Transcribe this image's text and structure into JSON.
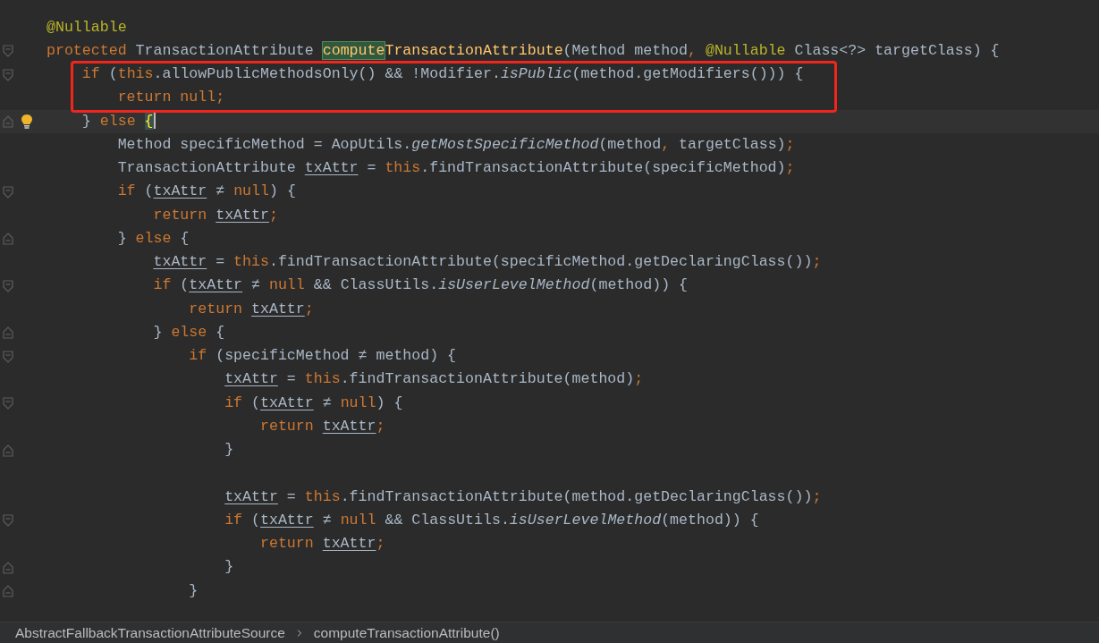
{
  "editor": {
    "lines": [
      {
        "tokens": [
          {
            "text": "@Nullable",
            "kind": "ann"
          }
        ],
        "current": false,
        "framed": false,
        "bulb": false
      },
      {
        "tokens": [
          {
            "text": "protected ",
            "kind": "kw"
          },
          {
            "text": "TransactionAttribute ",
            "kind": "plain"
          },
          {
            "text": "compute",
            "kind": "match"
          },
          {
            "text": "TransactionAttribute",
            "kind": "decl"
          },
          {
            "text": "(Method method",
            "kind": "plain"
          },
          {
            "text": ", ",
            "kind": "kw"
          },
          {
            "text": "@Nullable",
            "kind": "ann"
          },
          {
            "text": " Class<?> targetClass) {",
            "kind": "plain"
          }
        ],
        "fold_marker": {
          "kind": "open"
        },
        "current": false,
        "framed": false,
        "bulb": false
      },
      {
        "tokens": [
          {
            "text": "    if",
            "kind": "kw"
          },
          {
            "text": " (",
            "kind": "plain"
          },
          {
            "text": "this",
            "kind": "kw"
          },
          {
            "text": ".allowPublicMethodsOnly() && !Modifier.",
            "kind": "plain"
          },
          {
            "text": "isPublic",
            "kind": "static"
          },
          {
            "text": "(method.getModifiers())) {",
            "kind": "plain"
          }
        ],
        "fold_marker": {
          "kind": "open"
        },
        "current": false,
        "framed": true,
        "bulb": false
      },
      {
        "tokens": [
          {
            "text": "        return null;",
            "kind": "kw"
          }
        ],
        "current": false,
        "framed": true,
        "bulb": false
      },
      {
        "tokens": [
          {
            "text": "    }",
            "kind": "plain"
          },
          {
            "text": " else ",
            "kind": "kw"
          },
          {
            "text": "{",
            "kind": "brace"
          }
        ],
        "fold_marker": {
          "kind": "close"
        },
        "current": true,
        "framed": false,
        "bulb": true
      },
      {
        "tokens": [
          {
            "text": "        Method specificMethod = AopUtils.",
            "kind": "plain"
          },
          {
            "text": "getMostSpecificMethod",
            "kind": "static"
          },
          {
            "text": "(method",
            "kind": "plain"
          },
          {
            "text": ", ",
            "kind": "kw"
          },
          {
            "text": "targetClass)",
            "kind": "plain"
          },
          {
            "text": ";",
            "kind": "kw"
          }
        ],
        "current": false,
        "framed": false,
        "bulb": false
      },
      {
        "tokens": [
          {
            "text": "        TransactionAttribute ",
            "kind": "plain"
          },
          {
            "text": "txAttr",
            "kind": "var"
          },
          {
            "text": " = ",
            "kind": "plain"
          },
          {
            "text": "this",
            "kind": "kw"
          },
          {
            "text": ".findTransactionAttribute(specificMethod)",
            "kind": "plain"
          },
          {
            "text": ";",
            "kind": "kw"
          }
        ],
        "current": false,
        "framed": false,
        "bulb": false
      },
      {
        "tokens": [
          {
            "text": "        if",
            "kind": "kw"
          },
          {
            "text": " (",
            "kind": "plain"
          },
          {
            "text": "txAttr",
            "kind": "var"
          },
          {
            "text": " ≠ ",
            "kind": "plain"
          },
          {
            "text": "null",
            "kind": "kw"
          },
          {
            "text": ") {",
            "kind": "plain"
          }
        ],
        "fold_marker": {
          "kind": "open"
        },
        "current": false,
        "framed": false,
        "bulb": false
      },
      {
        "tokens": [
          {
            "text": "            return ",
            "kind": "kw"
          },
          {
            "text": "txAttr",
            "kind": "var"
          },
          {
            "text": ";",
            "kind": "kw"
          }
        ],
        "current": false,
        "framed": false,
        "bulb": false
      },
      {
        "tokens": [
          {
            "text": "        }",
            "kind": "plain"
          },
          {
            "text": " else",
            "kind": "kw"
          },
          {
            "text": " {",
            "kind": "plain"
          }
        ],
        "fold_marker": {
          "kind": "close"
        },
        "current": false,
        "framed": false,
        "bulb": false
      },
      {
        "tokens": [
          {
            "text": "            txAttr",
            "kind": "var"
          },
          {
            "text": " = ",
            "kind": "plain"
          },
          {
            "text": "this",
            "kind": "kw"
          },
          {
            "text": ".findTransactionAttribute(specificMethod.getDeclaringClass())",
            "kind": "plain"
          },
          {
            "text": ";",
            "kind": "kw"
          }
        ],
        "current": false,
        "framed": false,
        "bulb": false
      },
      {
        "tokens": [
          {
            "text": "            if",
            "kind": "kw"
          },
          {
            "text": " (",
            "kind": "plain"
          },
          {
            "text": "txAttr",
            "kind": "var"
          },
          {
            "text": " ≠ ",
            "kind": "plain"
          },
          {
            "text": "null",
            "kind": "kw"
          },
          {
            "text": " && ClassUtils.",
            "kind": "plain"
          },
          {
            "text": "isUserLevelMethod",
            "kind": "static"
          },
          {
            "text": "(method)) {",
            "kind": "plain"
          }
        ],
        "fold_marker": {
          "kind": "open"
        },
        "current": false,
        "framed": false,
        "bulb": false
      },
      {
        "tokens": [
          {
            "text": "                return ",
            "kind": "kw"
          },
          {
            "text": "txAttr",
            "kind": "var"
          },
          {
            "text": ";",
            "kind": "kw"
          }
        ],
        "current": false,
        "framed": false,
        "bulb": false
      },
      {
        "tokens": [
          {
            "text": "            }",
            "kind": "plain"
          },
          {
            "text": " else",
            "kind": "kw"
          },
          {
            "text": " {",
            "kind": "plain"
          }
        ],
        "fold_marker": {
          "kind": "close"
        },
        "current": false,
        "framed": false,
        "bulb": false
      },
      {
        "tokens": [
          {
            "text": "                if",
            "kind": "kw"
          },
          {
            "text": " (specificMethod ≠ method) {",
            "kind": "plain"
          }
        ],
        "fold_marker": {
          "kind": "open"
        },
        "current": false,
        "framed": false,
        "bulb": false
      },
      {
        "tokens": [
          {
            "text": "                    txAttr",
            "kind": "var"
          },
          {
            "text": " = ",
            "kind": "plain"
          },
          {
            "text": "this",
            "kind": "kw"
          },
          {
            "text": ".findTransactionAttribute(method)",
            "kind": "plain"
          },
          {
            "text": ";",
            "kind": "kw"
          }
        ],
        "current": false,
        "framed": false,
        "bulb": false
      },
      {
        "tokens": [
          {
            "text": "                    if",
            "kind": "kw"
          },
          {
            "text": " (",
            "kind": "plain"
          },
          {
            "text": "txAttr",
            "kind": "var"
          },
          {
            "text": " ≠ ",
            "kind": "plain"
          },
          {
            "text": "null",
            "kind": "kw"
          },
          {
            "text": ") {",
            "kind": "plain"
          }
        ],
        "fold_marker": {
          "kind": "open"
        },
        "current": false,
        "framed": false,
        "bulb": false
      },
      {
        "tokens": [
          {
            "text": "                        return ",
            "kind": "kw"
          },
          {
            "text": "txAttr",
            "kind": "var"
          },
          {
            "text": ";",
            "kind": "kw"
          }
        ],
        "current": false,
        "framed": false,
        "bulb": false
      },
      {
        "tokens": [
          {
            "text": "                    }",
            "kind": "plain"
          }
        ],
        "fold_marker": {
          "kind": "close"
        },
        "current": false,
        "framed": false,
        "bulb": false
      },
      {
        "blank_line_before": true,
        "tokens": [
          {
            "text": "                    txAttr",
            "kind": "var"
          },
          {
            "text": " = ",
            "kind": "plain"
          },
          {
            "text": "this",
            "kind": "kw"
          },
          {
            "text": ".findTransactionAttribute(method.getDeclaringClass())",
            "kind": "plain"
          },
          {
            "text": ";",
            "kind": "kw"
          }
        ],
        "current": false,
        "framed": false,
        "bulb": false
      },
      {
        "tokens": [
          {
            "text": "                    if",
            "kind": "kw"
          },
          {
            "text": " (",
            "kind": "plain"
          },
          {
            "text": "txAttr",
            "kind": "var"
          },
          {
            "text": " ≠ ",
            "kind": "plain"
          },
          {
            "text": "null",
            "kind": "kw"
          },
          {
            "text": " && ClassUtils.",
            "kind": "plain"
          },
          {
            "text": "isUserLevelMethod",
            "kind": "static"
          },
          {
            "text": "(method)) {",
            "kind": "plain"
          }
        ],
        "fold_marker": {
          "kind": "open"
        },
        "current": false,
        "framed": false,
        "bulb": false
      },
      {
        "tokens": [
          {
            "text": "                        return ",
            "kind": "kw"
          },
          {
            "text": "txAttr",
            "kind": "var"
          },
          {
            "text": ";",
            "kind": "kw"
          }
        ],
        "current": false,
        "framed": false,
        "bulb": false
      },
      {
        "tokens": [
          {
            "text": "                    }",
            "kind": "plain"
          }
        ],
        "fold_marker": {
          "kind": "close"
        },
        "current": false,
        "framed": false,
        "bulb": false
      },
      {
        "tokens": [
          {
            "text": "                }",
            "kind": "plain"
          }
        ],
        "fold_marker": {
          "kind": "close"
        },
        "current": false,
        "framed": false,
        "bulb": false
      }
    ]
  },
  "breadcrumb": [
    "AbstractFallbackTransactionAttributeSource",
    "computeTransactionAttribute()"
  ]
}
